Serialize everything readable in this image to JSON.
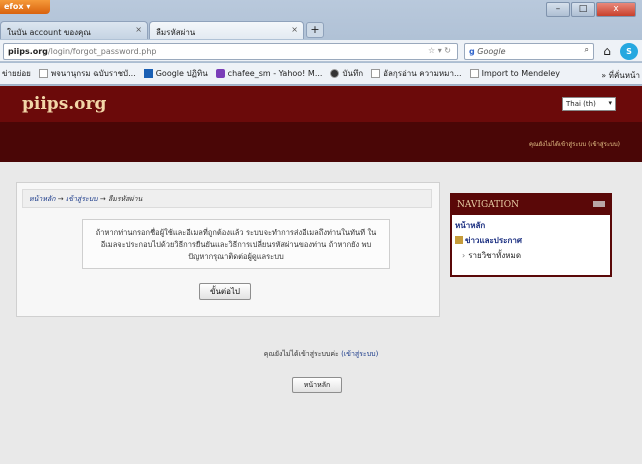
{
  "browser": {
    "menu_button": "efox ▾",
    "tabs": [
      {
        "label": "ในบัน account ของคุณ",
        "close": "×"
      },
      {
        "label": "ลืมรหัสผ่าน",
        "close": "×"
      }
    ],
    "new_tab": "+",
    "window_controls": [
      "–",
      "□",
      "x"
    ],
    "url": {
      "host": "piips.org",
      "path": "/login/forgot_password.php"
    },
    "search": {
      "engine": "g",
      "placeholder": "Google"
    },
    "bookmarks": [
      "ข่ายย่อย",
      "พจนานุกรม ฉบับราชบั...",
      "Google ปฏิทิน",
      "chafee_sm - Yahoo! M...",
      "บันทึก",
      "อัลกุรอ่าน ความหมา...",
      "Import to Mendeley"
    ],
    "bookmarks_more": "» ที่คั่นหน้า"
  },
  "header": {
    "site_name": "piips.org",
    "language": "Thai (th)",
    "login_info": "คุณยังไม่ได้เข้าสู่ระบบ (เข้าสู่ระบบ)"
  },
  "main": {
    "breadcrumb": {
      "home": "หน้าหลัก",
      "sep1": "→",
      "login": "เข้าสู่ระบบ",
      "sep2": "→",
      "current": "ลืมรหัสผ่าน"
    },
    "notice": "ถ้าหากท่านกรอกชื่อผู้ใช้และอีเมลที่ถูกต้องแล้ว ระบบจะทำการส่งอีเมลถึงท่านในทันที ในอีเมลจะประกอบไปด้วยวิธีการยืนยันและวิธีการเปลี่ยนรหัสผ่านของท่าน ถ้าหากยัง พบปัญหากรุณาติดต่อผู้ดูแลระบบ",
    "continue_button": "ขั้นต่อไป"
  },
  "navigation": {
    "title": "NAVIGATION",
    "items": [
      {
        "label": "หน้าหลัก"
      },
      {
        "label": "ข่าวและประกาศ"
      },
      {
        "label": "รายวิชาทั้งหมด"
      }
    ]
  },
  "footer": {
    "login_text": "คุณยังไม่ได้เข้าสู่ระบบค่ะ",
    "login_link": "(เข้าสู่ระบบ)",
    "home_button": "หน้าหลัก"
  }
}
